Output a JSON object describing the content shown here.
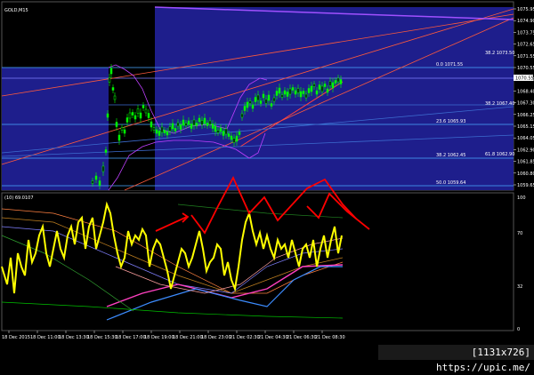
{
  "symbol": "GOLD,M15",
  "indicator_label": "(10) 69.0107",
  "price_ticks": [
    "1075.95",
    "1074.90",
    "1073.75",
    "1072.65",
    "1071.55",
    "1070.55",
    "1069.50",
    "1068.40",
    "1067.30",
    "1066.25",
    "1065.15",
    "1064.05",
    "1062.90",
    "1061.85",
    "1060.80",
    "1059.65"
  ],
  "current_price": "1070.55",
  "osc_ticks": [
    "100",
    "70",
    "32",
    "0"
  ],
  "fib_labels": [
    {
      "text": "0.0 1071.55",
      "y_price": 1071.55
    },
    {
      "text": "23.6 1065.93",
      "y_price": 1065.93
    },
    {
      "text": "38.2 1062.45",
      "y_price": 1062.45
    },
    {
      "text": "50.0 1059.64",
      "y_price": 1059.64
    }
  ],
  "right_fib_labels": [
    "38.2 1073.50",
    "38.2 1067.40",
    "61.8 1062.90"
  ],
  "time_ticks": [
    "18 Dec 2015",
    "18 Dec 11:00",
    "18 Dec 13:30",
    "18 Dec 15:30",
    "18 Dec 17:00",
    "18 Dec 19:00",
    "18 Dec 21:00",
    "18 Dec 23:00",
    "21 Dec 02:30",
    "21 Dec 04:30",
    "21 Dec 06:30",
    "21 Dec 08:30"
  ],
  "footer_text": "[1131x726] https://upic.me/",
  "colors": {
    "blue_box": "#1e1e8c",
    "candles": "#00ff00",
    "oscillator": "#ffff00",
    "arrows": "#ff0000",
    "trendline": "#ff4040",
    "bollinger": "#c040ff"
  }
}
